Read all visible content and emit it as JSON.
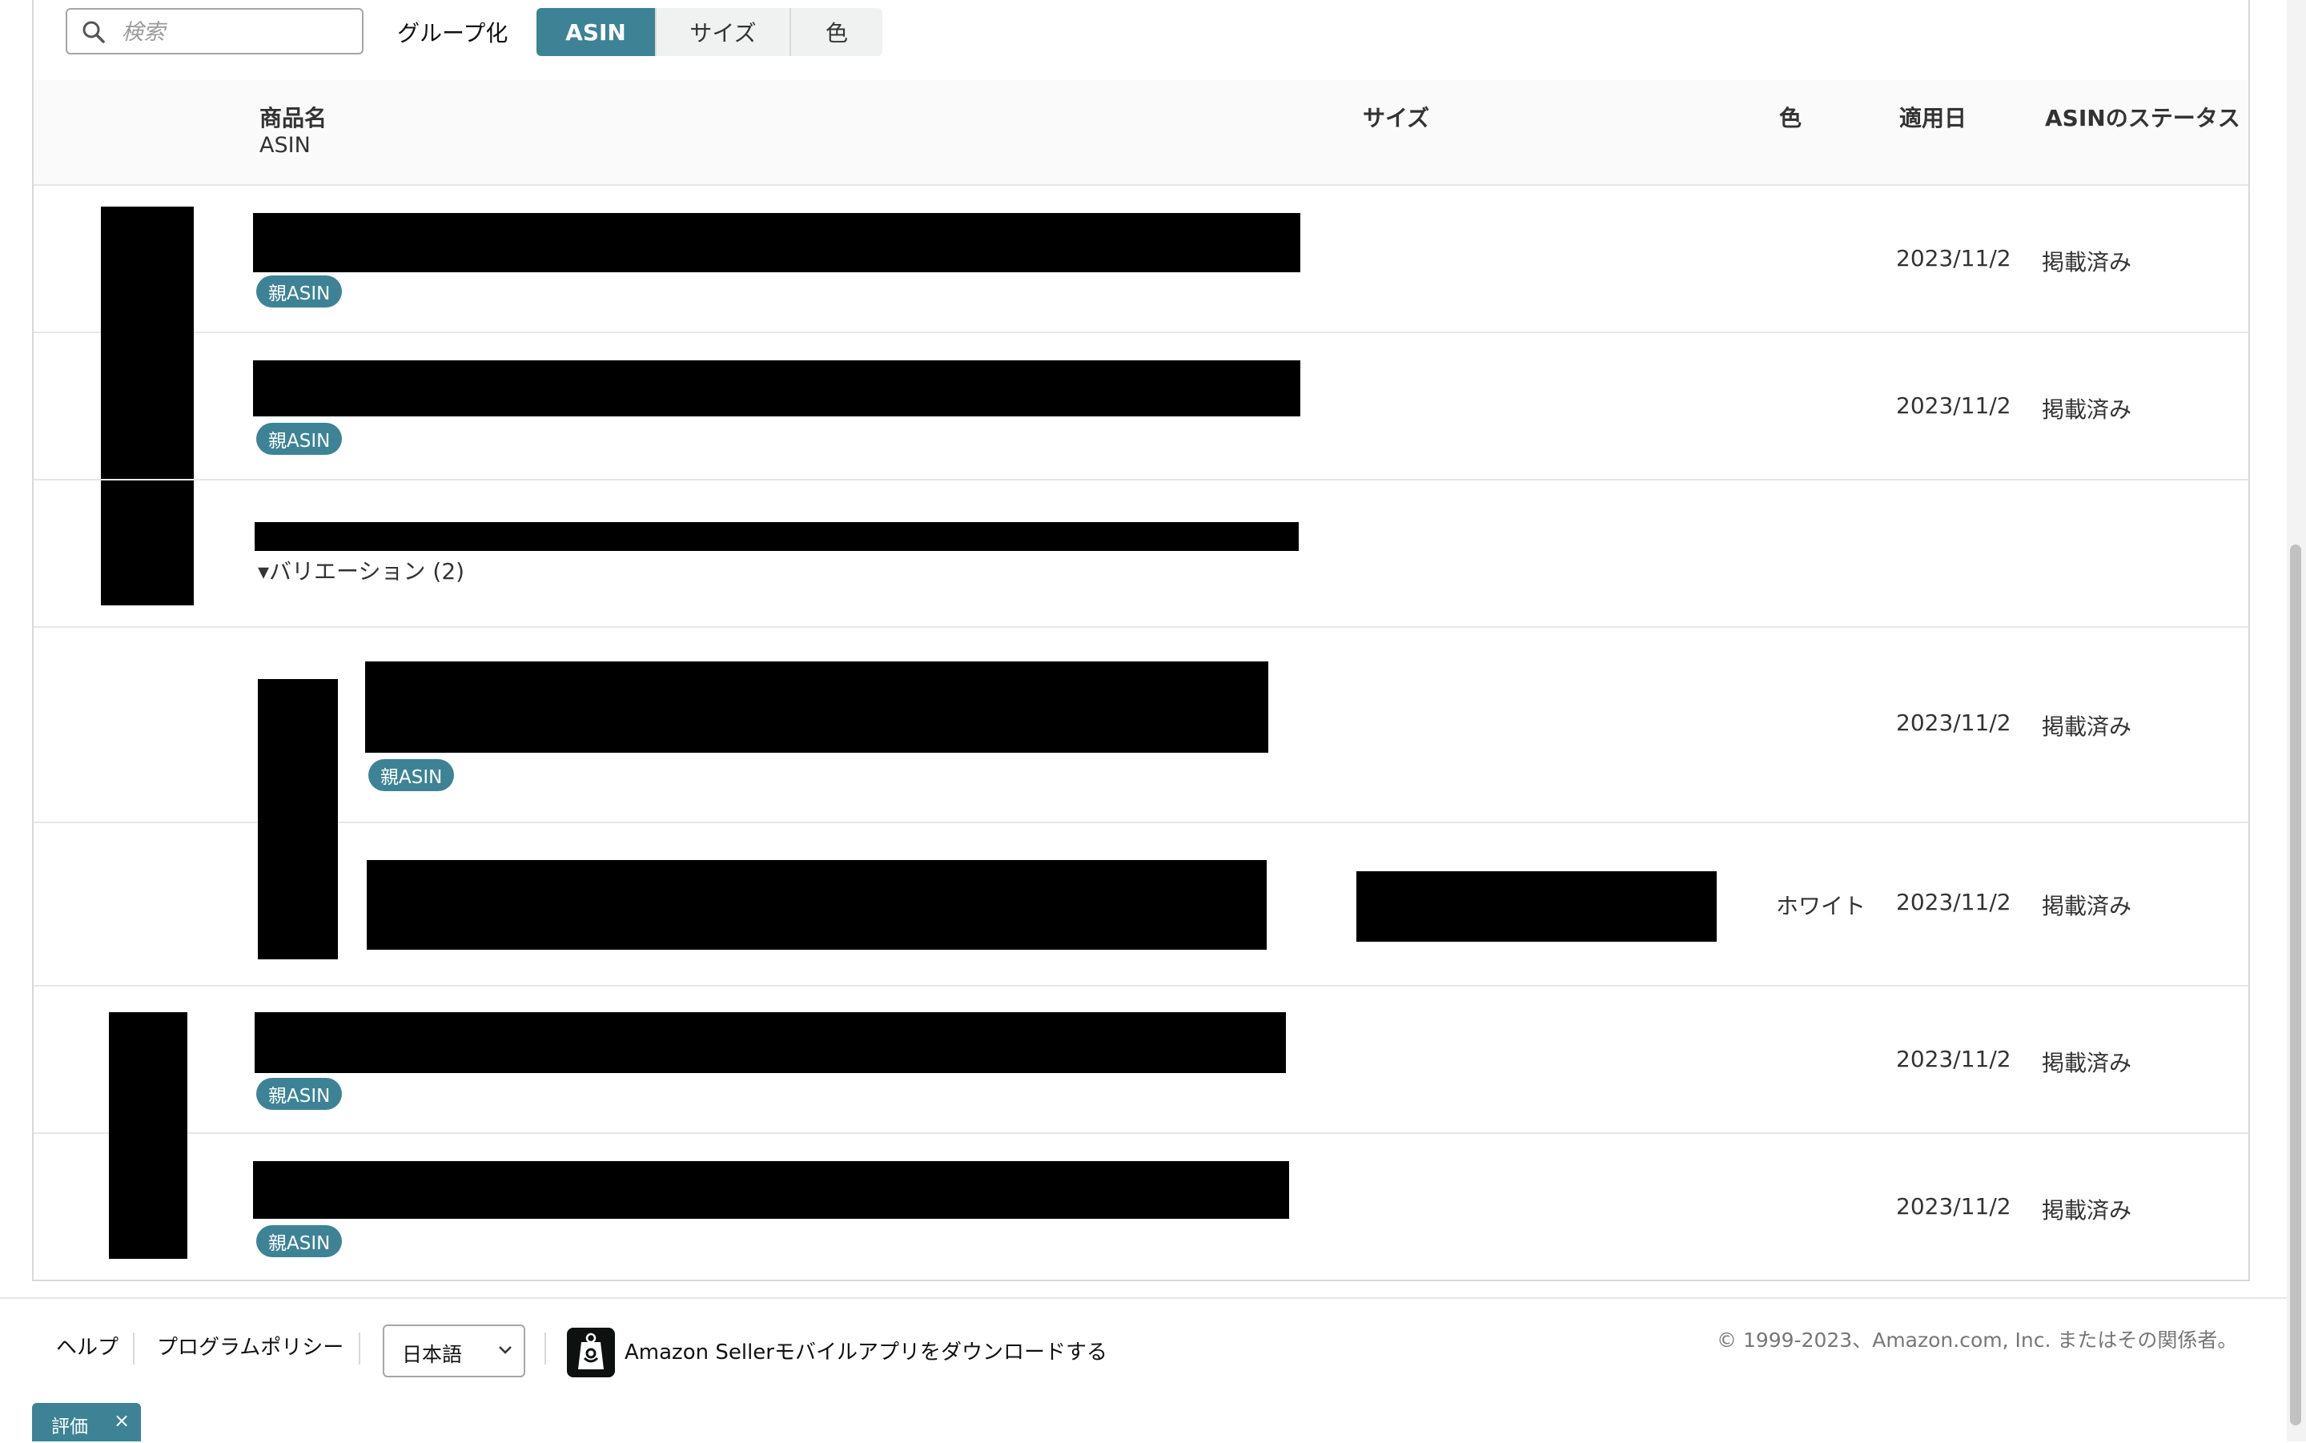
{
  "toolbar": {
    "search_placeholder": "検索",
    "group_label": "グループ化",
    "group_buttons": [
      {
        "label": "ASIN",
        "active": true
      },
      {
        "label": "サイズ",
        "active": false
      },
      {
        "label": "色",
        "active": false
      }
    ]
  },
  "table": {
    "headers": {
      "product_name": "商品名",
      "asin": "ASIN",
      "size": "サイズ",
      "color": "色",
      "applied_date": "適用日",
      "asin_status": "ASINのステータス"
    },
    "badge_label": "親ASIN",
    "variation_toggle": "▾バリエーション (2)",
    "rows": [
      {
        "date": "2023/11/2",
        "status": "掲載済み"
      },
      {
        "date": "2023/11/2",
        "status": "掲載済み"
      },
      {
        "date": "2023/11/2",
        "status": "掲載済み"
      },
      {
        "color": "ホワイト",
        "date": "2023/11/2",
        "status": "掲載済み"
      },
      {
        "date": "2023/11/2",
        "status": "掲載済み"
      },
      {
        "date": "2023/11/2",
        "status": "掲載済み"
      }
    ]
  },
  "footer": {
    "help": "ヘルプ",
    "policy": "プログラムポリシー",
    "language": "日本語",
    "app_download": "Amazon Sellerモバイルアプリをダウンロードする",
    "copyright": "© 1999-2023、Amazon.com, Inc. またはその関係者。"
  },
  "feedback_tab": {
    "label": "評価",
    "close": "×"
  },
  "colors": {
    "accent": "#3d8395",
    "border": "#e7e7e7"
  }
}
